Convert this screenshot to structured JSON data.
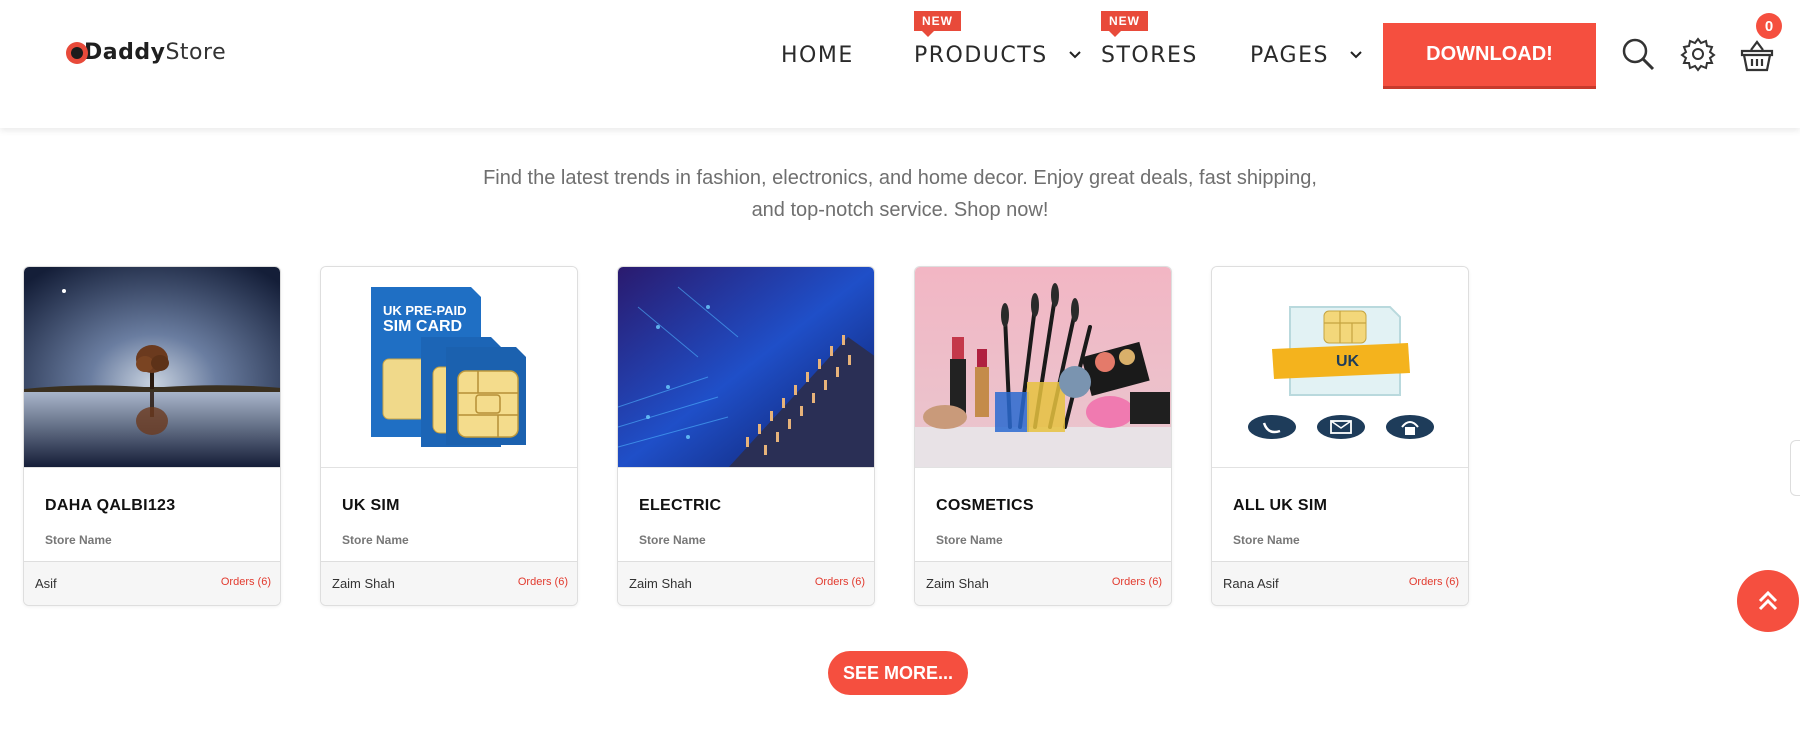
{
  "brand": {
    "logo_main": "Daddy",
    "logo_store": "Store"
  },
  "nav": {
    "items": [
      {
        "label": "HOME"
      },
      {
        "label": "PRODUCTS",
        "badge": "NEW"
      },
      {
        "label": "STORES",
        "badge": "NEW"
      },
      {
        "label": "PAGES"
      }
    ],
    "download_label": "DOWNLOAD!",
    "cart_count": "0"
  },
  "intro": {
    "line1": "Find the latest trends in fashion, electronics, and home decor. Enjoy great deals, fast shipping,",
    "line2": "and top-notch service. Shop now!"
  },
  "stores": [
    {
      "title": "DAHA QALBI123",
      "subtitle": "Store Name",
      "owner": "Asif",
      "orders": "Orders (6)",
      "image": "night-tree-reflection"
    },
    {
      "title": "UK SIM",
      "subtitle": "Store Name",
      "owner": "Zaim Shah",
      "orders": "Orders (6)",
      "image": "uk-prepaid-sim-card",
      "image_text1": "UK PRE-PAID",
      "image_text2": "SIM CARD"
    },
    {
      "title": "ELECTRIC",
      "subtitle": "Store Name",
      "owner": "Zaim Shah",
      "orders": "Orders (6)",
      "image": "circuit-chip"
    },
    {
      "title": "COSMETICS",
      "subtitle": "Store Name",
      "owner": "Zaim Shah",
      "orders": "Orders (6)",
      "image": "makeup-products"
    },
    {
      "title": "ALL UK SIM",
      "subtitle": "Store Name",
      "owner": "Rana Asif",
      "orders": "Orders (6)",
      "image": "uk-sim-icons",
      "image_text1": "UK"
    }
  ],
  "see_more_label": "SEE MORE...",
  "colors": {
    "accent": "#f54f3f",
    "text_muted": "#6f6f6f",
    "orders": "#e23a2e"
  },
  "icons": [
    "search-icon",
    "gear-icon",
    "basket-icon",
    "chevron-down-icon",
    "double-chevron-up-icon"
  ]
}
